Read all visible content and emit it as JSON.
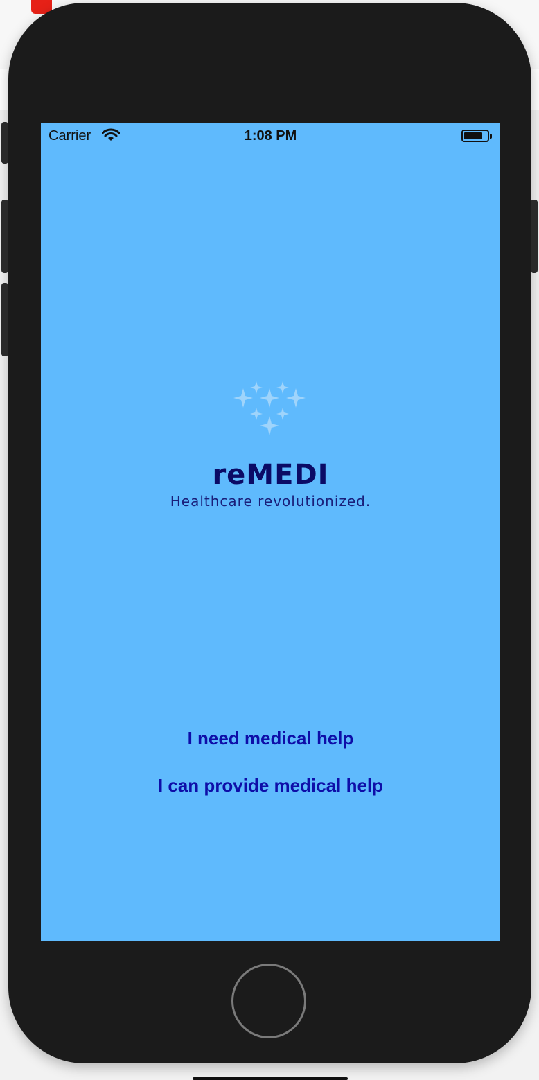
{
  "status_bar": {
    "carrier": "Carrier",
    "time": "1:08 PM",
    "battery_level": 0.8
  },
  "brand": {
    "name": "reMEDI",
    "tagline": "Healthcare revolutionized."
  },
  "actions": {
    "need_help": "I need medical help",
    "provide_help": "I can provide medical help"
  },
  "colors": {
    "screen_background": "#5fbafd",
    "brand_text": "#0b0b66",
    "action_text": "#0e0ea8",
    "logo_sparkle": "#9fd4fb"
  }
}
